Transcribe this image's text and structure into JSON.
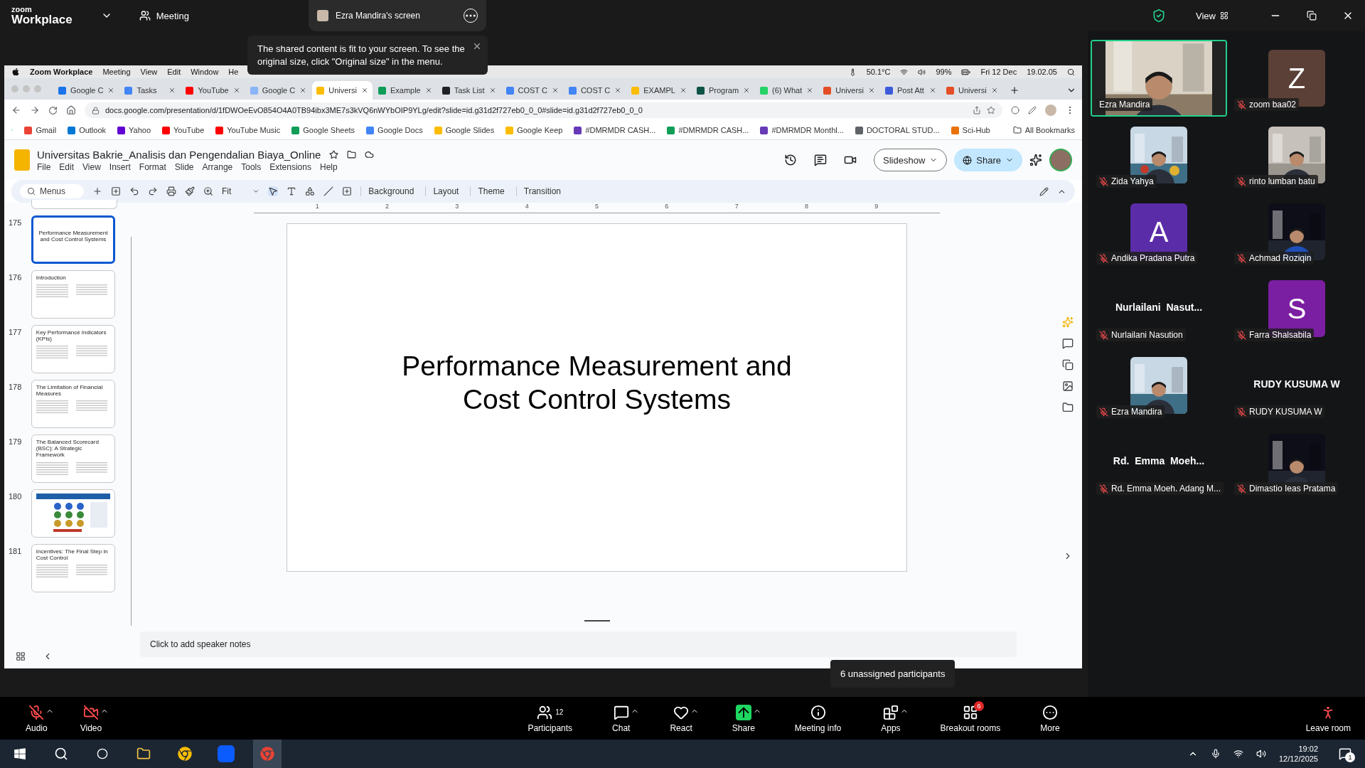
{
  "zoom_top": {
    "logo_top": "zoom",
    "logo_bottom": "Workplace",
    "meeting": "Meeting",
    "share_tab": "Ezra Mandira's screen",
    "view": "View"
  },
  "fit_notice": {
    "text": "The shared content is fit to your screen. To see the original size, click \"Original size\" in the menu."
  },
  "mac_menu": {
    "items": [
      "Zoom Workplace",
      "Meeting",
      "View",
      "Edit",
      "Window",
      "He"
    ],
    "temp": "50.1°C",
    "battery": "99%",
    "date": "Fri 12 Dec",
    "time": "19.02.05"
  },
  "browser_tabs": [
    {
      "label": "Google C",
      "color": "#1a73e8",
      "selected": false
    },
    {
      "label": "Tasks",
      "color": "#4285f4",
      "selected": false
    },
    {
      "label": "YouTube",
      "color": "#ff0000",
      "selected": false
    },
    {
      "label": "Google C",
      "color": "#8ab4f8",
      "selected": false
    },
    {
      "label": "Universi",
      "color": "#fbbc04",
      "selected": true
    },
    {
      "label": "Example",
      "color": "#0f9d58",
      "selected": false
    },
    {
      "label": "Task List",
      "color": "#202124",
      "selected": false
    },
    {
      "label": "COST C",
      "color": "#4285f4",
      "selected": false
    },
    {
      "label": "COST C",
      "color": "#4285f4",
      "selected": false
    },
    {
      "label": "EXAMPL",
      "color": "#fbbc04",
      "selected": false
    },
    {
      "label": "Program",
      "color": "#0b5345",
      "selected": false
    },
    {
      "label": "(6) What",
      "color": "#25d366",
      "selected": false
    },
    {
      "label": "Universi",
      "color": "#e44d26",
      "selected": false
    },
    {
      "label": "Post Att",
      "color": "#3b5bdb",
      "selected": false
    },
    {
      "label": "Universi",
      "color": "#e44d26",
      "selected": false
    }
  ],
  "address": "docs.google.com/presentation/d/1fDWOeEvO854O4A0TB94ibx3ME7s3kVQ6nWYbOIP9YLg/edit?slide=id.g31d2f727eb0_0_0#slide=id.g31d2f727eb0_0_0",
  "bookmarks": [
    {
      "label": "Gmail",
      "color": "#ea4335"
    },
    {
      "label": "Outlook",
      "color": "#0078d4"
    },
    {
      "label": "Yahoo",
      "color": "#6001d2"
    },
    {
      "label": "YouTube",
      "color": "#ff0000"
    },
    {
      "label": "YouTube Music",
      "color": "#ff0000"
    },
    {
      "label": "Google Sheets",
      "color": "#0f9d58"
    },
    {
      "label": "Google Docs",
      "color": "#4285f4"
    },
    {
      "label": "Google Slides",
      "color": "#fbbc04"
    },
    {
      "label": "Google Keep",
      "color": "#fbbc04"
    },
    {
      "label": "#DMRMDR CASH...",
      "color": "#673ab7"
    },
    {
      "label": "#DMRMDR CASH...",
      "color": "#0f9d58"
    },
    {
      "label": "#DMRMDR Monthl...",
      "color": "#673ab7"
    },
    {
      "label": "DOCTORAL STUD...",
      "color": "#5f6368"
    },
    {
      "label": "Sci-Hub",
      "color": "#e8710a"
    }
  ],
  "all_bookmarks": "All Bookmarks",
  "doc": {
    "title": "Universitas Bakrie_Analisis dan Pengendalian Biaya_Online",
    "menu": [
      "File",
      "Edit",
      "View",
      "Insert",
      "Format",
      "Slide",
      "Arrange",
      "Tools",
      "Extensions",
      "Help"
    ],
    "slideshow": "Slideshow",
    "share": "Share"
  },
  "toolbar": {
    "search": "Menus",
    "zoom": "Fit",
    "buttons": [
      "Background",
      "Layout",
      "Theme",
      "Transition"
    ]
  },
  "ruler": [
    "1",
    "2",
    "3",
    "4",
    "5",
    "6",
    "7",
    "8",
    "9"
  ],
  "slides": [
    {
      "number": "175",
      "kind": "title",
      "title": "Performance Measurement and Cost Control Systems",
      "selected": true
    },
    {
      "number": "176",
      "kind": "text",
      "title": "Introduction",
      "selected": false
    },
    {
      "number": "177",
      "kind": "text",
      "title": "Key Performance Indicators (KPIs)",
      "selected": false
    },
    {
      "number": "178",
      "kind": "text",
      "title": "The Limitation of Financial Measures",
      "selected": false
    },
    {
      "number": "179",
      "kind": "text",
      "title": "The Balanced Scorecard (BSC): A Strategic Framework",
      "selected": false
    },
    {
      "number": "180",
      "kind": "diagram",
      "selected": false
    },
    {
      "number": "181",
      "kind": "text",
      "title": "Incentives: The Final Step in Cost Control",
      "selected": false
    }
  ],
  "slide": {
    "title": "Performance Measurement and Cost Control Systems"
  },
  "notes": {
    "placeholder": "Click to add speaker notes"
  },
  "participants": [
    {
      "kind": "video",
      "name": "Ezra Mandira",
      "muted": false,
      "speaking": true
    },
    {
      "kind": "letter",
      "letter": "Z",
      "color": "#5b4037",
      "name": "zoom baa02",
      "muted": true,
      "speaking": false
    },
    {
      "name": "Zida Yahya",
      "muted": true,
      "speaking": false
    },
    {
      "name": "rinto lumban batu",
      "muted": true,
      "speaking": false
    },
    {
      "kind": "letter",
      "letter": "A",
      "color": "#5b2ca8",
      "name": "Andika Pradana Putra",
      "muted": true,
      "speaking": false
    },
    {
      "name": "Achmad Roziqin",
      "muted": true,
      "speaking": false
    },
    {
      "kind": "name",
      "display": "Nurlailani  Nasut...",
      "name": "Nurlailani Nasution",
      "muted": true,
      "speaking": false
    },
    {
      "kind": "letter",
      "letter": "S",
      "color": "#7b1fa2",
      "name": "Farra Shalsabila",
      "muted": true,
      "speaking": false
    },
    {
      "name": "Ezra Mandira",
      "muted": true,
      "speaking": false
    },
    {
      "kind": "name",
      "display": "RUDY KUSUMA W",
      "name": "RUDY KUSUMA W",
      "muted": true,
      "speaking": false
    },
    {
      "kind": "name",
      "display": "Rd.  Emma  Moeh...",
      "name": "Rd. Emma Moeh. Adang M...",
      "muted": true,
      "speaking": false
    },
    {
      "name": "Dimastio Ieas Pratama",
      "muted": true,
      "speaking": false
    }
  ],
  "unassigned_tip": "6 unassigned participants",
  "controls": [
    {
      "kind": "audio",
      "label": "Audio",
      "muted": true,
      "caret": true
    },
    {
      "kind": "video",
      "label": "Video",
      "muted": true,
      "caret": true
    },
    {
      "kind": "participants",
      "label": "Participants",
      "count": "12",
      "caret": false
    },
    {
      "kind": "chat",
      "label": "Chat",
      "caret": true
    },
    {
      "kind": "react",
      "label": "React",
      "caret": true
    },
    {
      "kind": "share",
      "label": "Share",
      "caret": true
    },
    {
      "kind": "info",
      "label": "Meeting info",
      "caret": false
    },
    {
      "kind": "apps",
      "label": "Apps",
      "caret": true
    },
    {
      "kind": "breakout",
      "label": "Breakout rooms",
      "badge": "6",
      "caret": false
    },
    {
      "kind": "more",
      "label": "More",
      "caret": false
    }
  ],
  "leave": "Leave room",
  "taskbar": {
    "time": "19:02",
    "date": "12/12/2025",
    "notifications": "1"
  }
}
